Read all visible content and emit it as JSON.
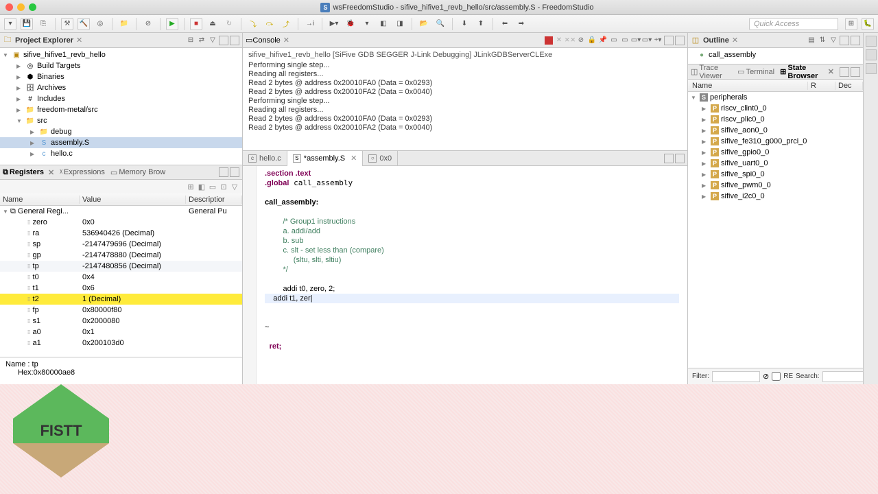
{
  "window": {
    "title": "wsFreedomStudio - sifive_hifive1_revb_hello/src/assembly.S - FreedomStudio"
  },
  "quick_access": "Quick Access",
  "project_explorer": {
    "title": "Project Explorer",
    "root": "sifive_hifive1_revb_hello",
    "items": [
      "Build Targets",
      "Binaries",
      "Archives",
      "Includes",
      "freedom-metal/src"
    ],
    "src_label": "src",
    "src_children": [
      "debug",
      "assembly.S",
      "hello.c"
    ]
  },
  "debug_tabs": {
    "registers": "Registers",
    "expressions": "Expressions",
    "memory": "Memory Brow"
  },
  "registers": {
    "cols": {
      "name": "Name",
      "value": "Value",
      "desc": "Descriptior"
    },
    "group": "General Regi...",
    "group_desc": "General Pu",
    "rows": [
      {
        "n": "zero",
        "v": "0x0"
      },
      {
        "n": "ra",
        "v": "536940426 (Decimal)"
      },
      {
        "n": "sp",
        "v": "-2147479696 (Decimal)"
      },
      {
        "n": "gp",
        "v": "-2147478880 (Decimal)"
      },
      {
        "n": "tp",
        "v": "-2147480856 (Decimal)",
        "sel": true
      },
      {
        "n": "t0",
        "v": "0x4"
      },
      {
        "n": "t1",
        "v": "0x6"
      },
      {
        "n": "t2",
        "v": "1 (Decimal)",
        "hl": true
      },
      {
        "n": "fp",
        "v": "0x80000f80"
      },
      {
        "n": "s1",
        "v": "0x2000080"
      },
      {
        "n": "a0",
        "v": "0x1"
      },
      {
        "n": "a1",
        "v": "0x200103d0"
      }
    ],
    "detail_name": "Name : tp",
    "detail_hex": "Hex:0x80000ae8"
  },
  "console": {
    "title": "Console",
    "selection": "sifive_hifive1_revb_hello [SiFive GDB SEGGER J-Link Debugging] JLinkGDBServerCLExe",
    "lines": [
      "Performing single step...",
      "Reading all registers...",
      "Read 2 bytes @ address 0x20010FA0 (Data = 0x0293)",
      "Read 2 bytes @ address 0x20010FA2 (Data = 0x0040)",
      "Performing single step...",
      "Reading all registers...",
      "Read 2 bytes @ address 0x20010FA0 (Data = 0x0293)",
      "Read 2 bytes @ address 0x20010FA2 (Data = 0x0040)"
    ]
  },
  "editor": {
    "tabs": [
      {
        "label": "hello.c",
        "icon": "c"
      },
      {
        "label": "*assembly.S",
        "icon": "S",
        "active": true
      },
      {
        "label": "0x0",
        "icon": "o"
      }
    ],
    "code": {
      "l1": ".section .text",
      "l2": ".global call_assembly",
      "l3": "call_assembly:",
      "l4": "/* Group1 instructions",
      "l5": "a. addi/add",
      "l6": "b. sub",
      "l7": "c. slt - set less than (compare)",
      "l8": "     (sltu, slti, sltiu)",
      "l9": "*/",
      "l10": "addi t0, zero, 2;",
      "l11": "addi t1, zer",
      "l12": "~",
      "l13": "ret;"
    }
  },
  "outline": {
    "title": "Outline",
    "item": "call_assembly"
  },
  "state": {
    "tabs": {
      "trace": "Trace Viewer",
      "term": "Terminal",
      "browser": "State Browser"
    },
    "cols": {
      "name": "Name",
      "r": "R",
      "dec": "Dec"
    },
    "root": "peripherals",
    "items": [
      "riscv_clint0_0",
      "riscv_plic0_0",
      "sifive_aon0_0",
      "sifive_fe310_g000_prci_0",
      "sifive_gpio0_0",
      "sifive_uart0_0",
      "sifive_spi0_0",
      "sifive_pwm0_0",
      "sifive_i2c0_0"
    ]
  },
  "filter": {
    "filter_label": "Filter:",
    "re": "RE",
    "search_label": "Search:"
  },
  "badge": "FISTT"
}
